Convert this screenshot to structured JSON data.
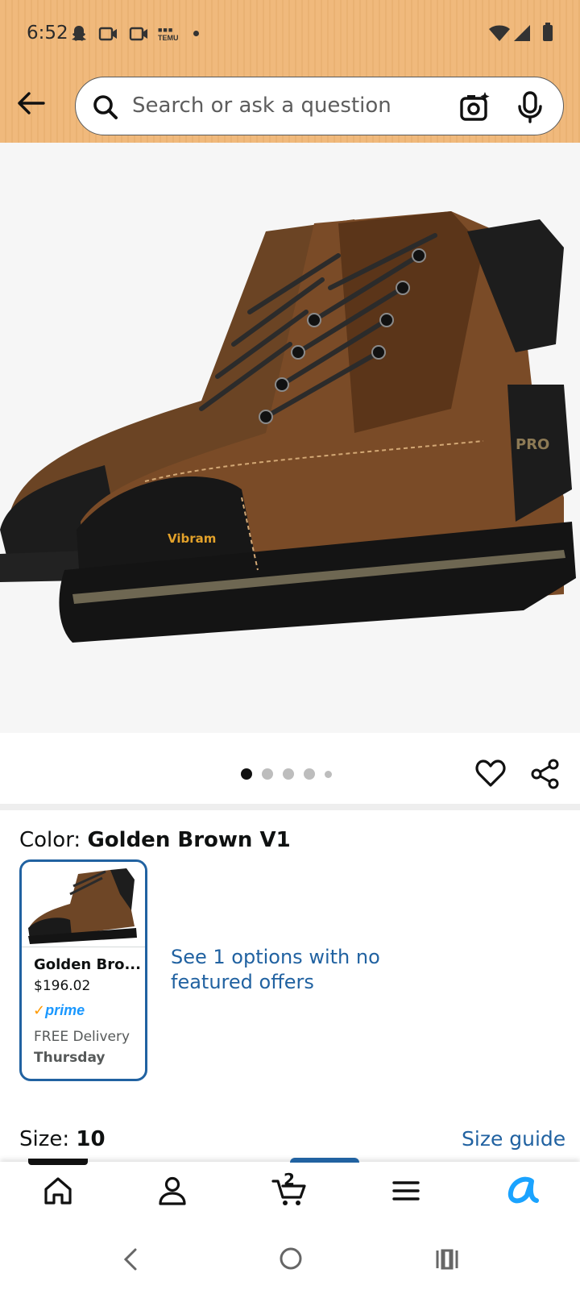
{
  "status_bar": {
    "time": "6:52",
    "temu_badge": "TEMU"
  },
  "search": {
    "placeholder": "Search or ask a question"
  },
  "gallery": {
    "image_count": 5,
    "active_index": 0
  },
  "product": {
    "color_label": "Color: ",
    "color_value": "Golden Brown V1",
    "swatch": {
      "name": "Golden Bro...",
      "price": "$196.02",
      "prime": "prime",
      "delivery": "FREE Delivery",
      "day": "Thursday"
    },
    "options_link": "See 1 options with no featured offers",
    "size_label": "Size: ",
    "size_value": "10",
    "size_guide": "Size guide"
  },
  "bottom_nav": {
    "cart_count": "2"
  },
  "colors": {
    "header_bg": "#f0b97c",
    "link": "#2162a1",
    "prime_blue": "#1a98ff",
    "prime_check": "#ff9900"
  }
}
